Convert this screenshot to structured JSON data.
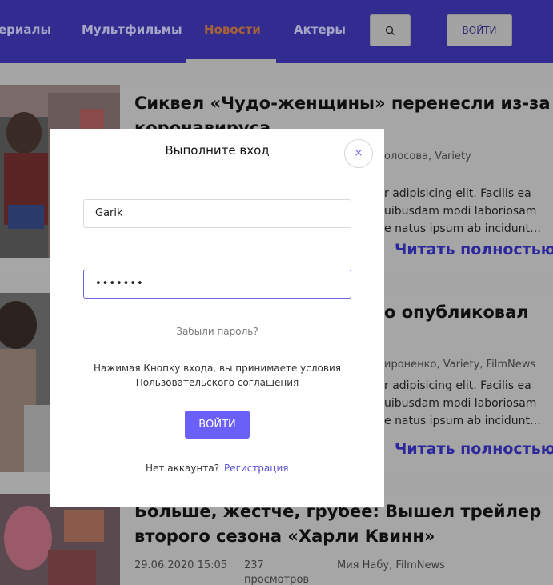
{
  "nav": {
    "items": [
      {
        "label": "ериалы"
      },
      {
        "label": "Мультфильмы"
      },
      {
        "label": "Новости"
      },
      {
        "label": "Актеры"
      }
    ],
    "login_label": "ВОЙТИ"
  },
  "cards": [
    {
      "title_lines": [
        "Сиквел «Чудо-женщины» перенесли из-за",
        "коронавируса"
      ],
      "meta_authors": "олосова, Variety",
      "text_lines": [
        "r adipisicing elit. Facilis ea",
        "uibusdam modi laboriosam",
        "e natus ipsum ab incidunt…"
      ],
      "read_more": "Читать полностью"
    },
    {
      "title_lines": [
        "о опубликовал"
      ],
      "meta_authors": "ироненко, Variety, FilmNews",
      "text_lines": [
        "r adipisicing elit. Facilis ea",
        "uibusdam modi laboriosam",
        "e natus ipsum ab incidunt…"
      ],
      "read_more": "Читать полностью"
    },
    {
      "title_lines": [
        "Больше, жестче, грубее: Вышел трейлер",
        "второго сезона «Харли Квинн»"
      ],
      "meta_date": "29.06.2020 15:05",
      "meta_views_count": "237",
      "meta_views_label": "просмотров",
      "meta_authors": "Мия Набу, FilmNews"
    }
  ],
  "modal": {
    "title": "Выполните вход",
    "close_glyph": "×",
    "username_value": "Garik",
    "password_value": "•••••••",
    "forgot_label": "Забыли пароль?",
    "terms_line1": "Нажимая Кнопку входа, вы принимаете условия",
    "terms_line2": "Пользовательского соглашения",
    "submit_label": "ВОЙТИ",
    "no_account_label": "Нет аккаунта?",
    "register_label": "Регистрация"
  },
  "colors": {
    "header": "#322c90",
    "accent": "#6a5ff7",
    "overlay": "#a5a5a5"
  }
}
